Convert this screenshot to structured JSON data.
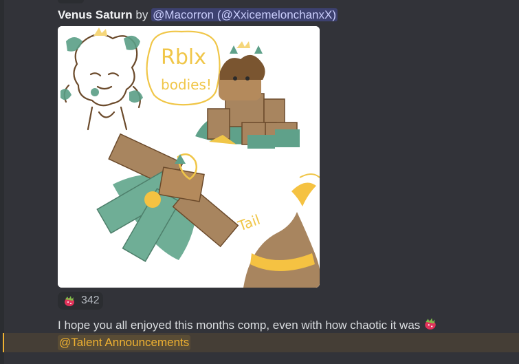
{
  "message": {
    "title": "Venus Saturn",
    "by_text": "by",
    "author_mention": "@Macorron (@XxicemelonchanxX)",
    "attachment": {
      "handwritten_rblx": "Rblx",
      "handwritten_bodies": "bodies!",
      "handwritten_tail": "Tail"
    },
    "reaction": {
      "emoji": "dragonfruit-emoji",
      "count": "342"
    },
    "body_text": "I hope you all enjoyed this months comp, even with how chaotic it was",
    "body_emoji": "dragonfruit-emoji",
    "role_mention": "@Talent Announcements"
  },
  "colors": {
    "background": "#323339",
    "mention_bg": "#5865f2",
    "role_mention": "#f0b232",
    "reaction_bg": "#2b2d31"
  }
}
